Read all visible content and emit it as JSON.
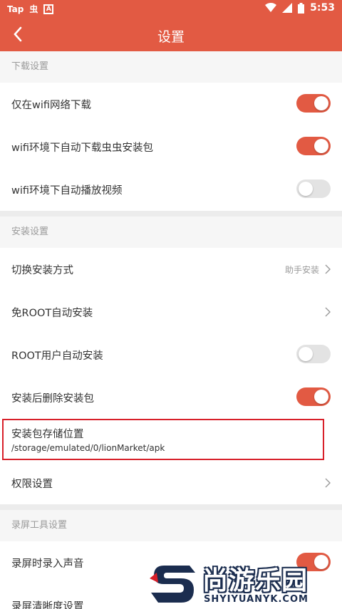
{
  "status_bar": {
    "left_icons": [
      "Tap",
      "虫"
    ],
    "time": "5:53",
    "icon_names": [
      "wifi-icon",
      "signal-icon",
      "battery-icon"
    ]
  },
  "app_bar": {
    "title": "设置",
    "back_icon": "back-arrow-icon"
  },
  "sections": {
    "download": {
      "header": "下载设置",
      "wifi_only": {
        "label": "仅在wifi网络下载",
        "on": true
      },
      "auto_pkg": {
        "label": "wifi环境下自动下载虫虫安装包",
        "on": true
      },
      "auto_play": {
        "label": "wifi环境下自动播放视频",
        "on": false
      }
    },
    "install": {
      "header": "安装设置",
      "switch_method": {
        "label": "切换安装方式",
        "value": "助手安装"
      },
      "no_root": {
        "label": "免ROOT自动安装"
      },
      "root_auto": {
        "label": "ROOT用户自动安装",
        "on": false
      },
      "delete_after": {
        "label": "安装后删除安装包",
        "on": true
      },
      "storage": {
        "label": "安装包存储位置",
        "path": "/storage/emulated/0/lionMarket/apk"
      },
      "permission": {
        "label": "权限设置"
      }
    },
    "recording": {
      "header": "录屏工具设置",
      "record_audio": {
        "label": "录屏时录入声音",
        "on": true
      },
      "clarity": {
        "label": "录屏清晰度设置"
      }
    }
  },
  "colors": {
    "accent": "#e25a43",
    "highlight_border": "#d8202a"
  },
  "watermark": {
    "title": "尚游乐园",
    "url": "SHYIYUANYK.COM"
  }
}
